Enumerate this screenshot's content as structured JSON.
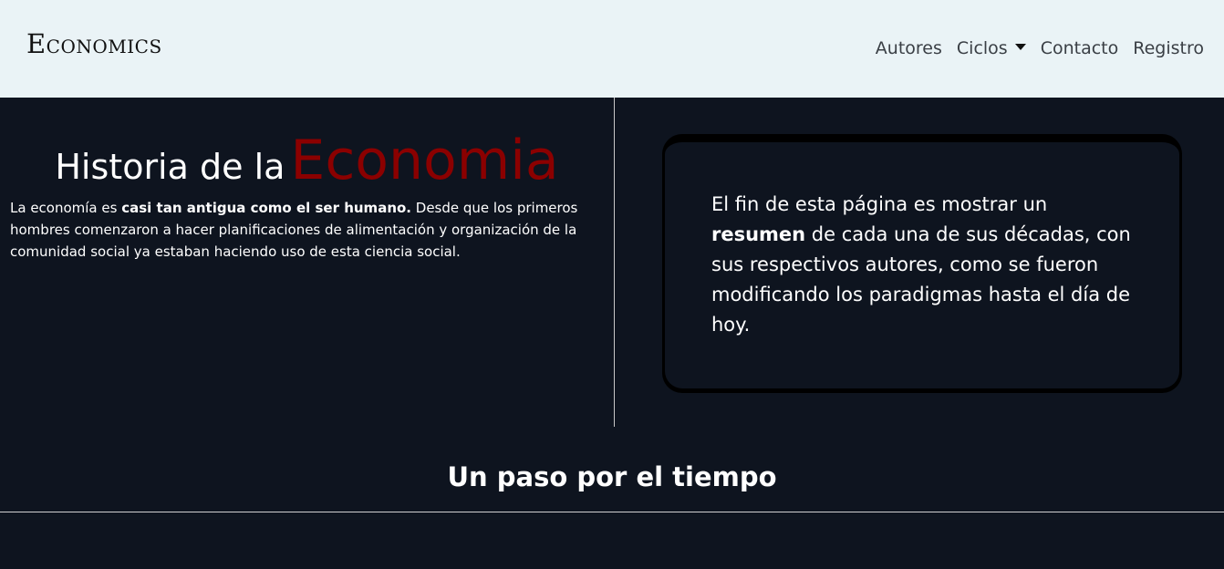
{
  "navbar": {
    "brand": "Economics",
    "links": {
      "autores": "Autores",
      "ciclos": "Ciclos",
      "contacto": "Contacto",
      "registro": "Registro"
    }
  },
  "hero": {
    "title_part1": "Historia de la",
    "title_part2": "Economia",
    "intro_start": "La economía es ",
    "intro_bold": "casi tan antigua como el ser humano.",
    "intro_end": " Desde que los primeros hombres comenzaron a hacer planificaciones de alimentación y organización de la comunidad social ya estaban haciendo uso de esta ciencia social."
  },
  "card": {
    "text_start": "El fin de esta página es mostrar un ",
    "text_bold": "resumen",
    "text_end": " de cada una de sus décadas, con sus respectivos autores, como se fueron modificando los paradigmas hasta el día de hoy."
  },
  "section": {
    "title": "Un paso por el tiempo"
  },
  "colors": {
    "navbar_bg": "#eaf3f6",
    "page_bg": "#0e141f",
    "accent_title": "#8b0000"
  },
  "icons": {
    "dropdown": "caret-down-icon"
  }
}
